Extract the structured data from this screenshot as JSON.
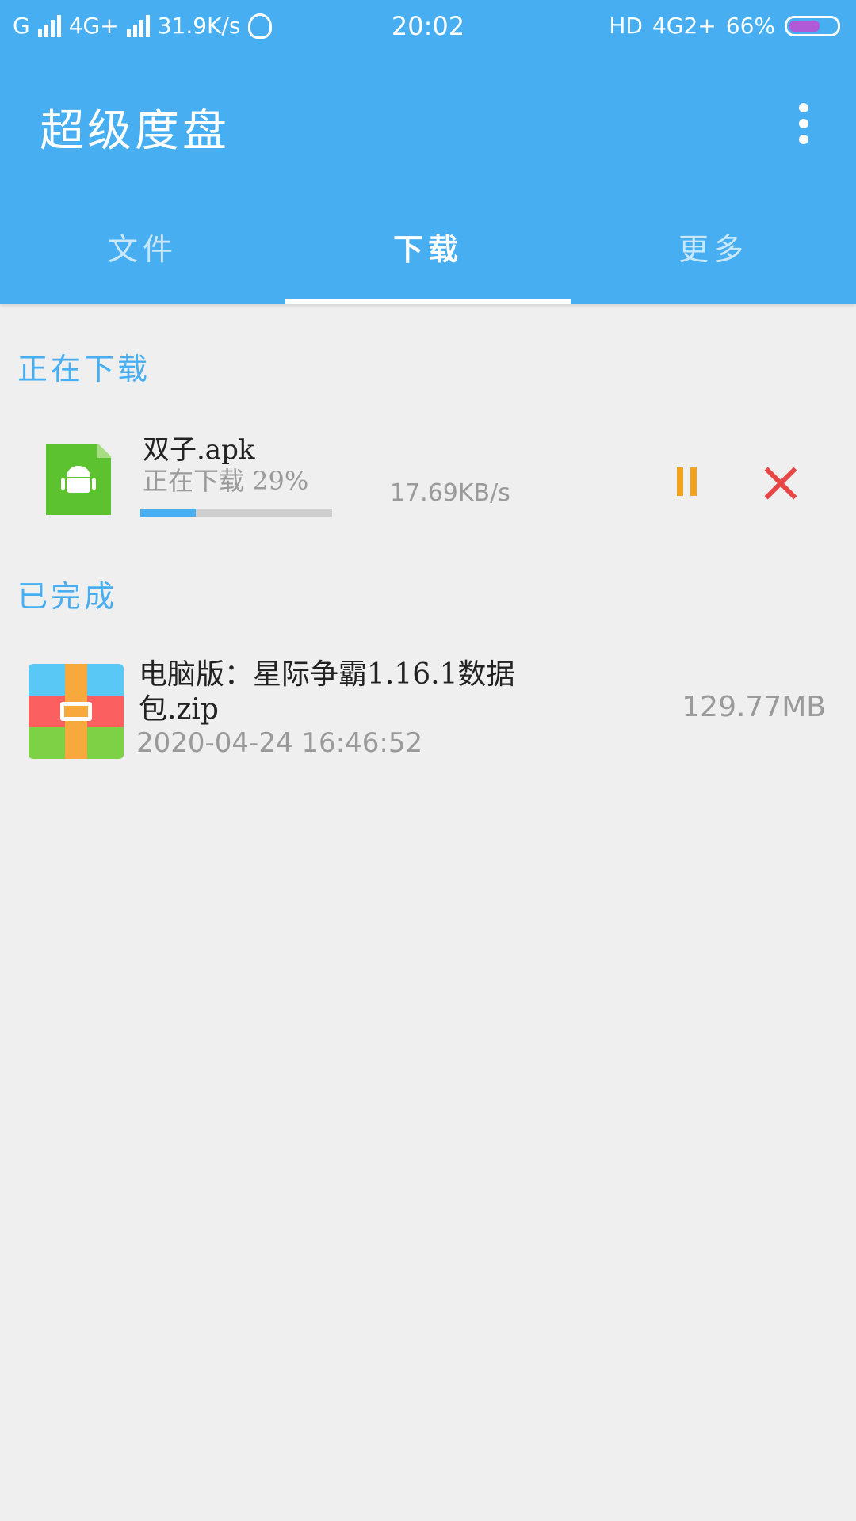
{
  "status_bar": {
    "network1": "G",
    "network2": "4G+",
    "speed": "31.9K/s",
    "time": "20:02",
    "hd": "HD",
    "network3": "4G2+",
    "battery": "66%",
    "battery_level_percent": 66
  },
  "app": {
    "title": "超级度盘",
    "more_icon": "more-vert-icon"
  },
  "tabs": [
    {
      "label": "文件",
      "active": false
    },
    {
      "label": "下载",
      "active": true
    },
    {
      "label": "更多",
      "active": false
    }
  ],
  "downloading": {
    "section_title": "正在下载",
    "items": [
      {
        "name": "双子.apk",
        "status": "正在下载 29%",
        "progress_percent": 29,
        "speed": "17.69KB/s",
        "icon": "android-apk-icon",
        "pause_icon": "pause-icon",
        "cancel_icon": "close-icon"
      }
    ]
  },
  "completed": {
    "section_title": "已完成",
    "items": [
      {
        "name": "电脑版：星际争霸1.16.1数据包.zip",
        "date": "2020-04-24 16:46:52",
        "size": "129.77MB",
        "icon": "zip-archive-icon"
      }
    ]
  },
  "colors": {
    "primary": "#46aef1",
    "background": "#efefef",
    "pause": "#f3a21b",
    "cancel": "#e84545",
    "apk": "#5cc22f"
  }
}
